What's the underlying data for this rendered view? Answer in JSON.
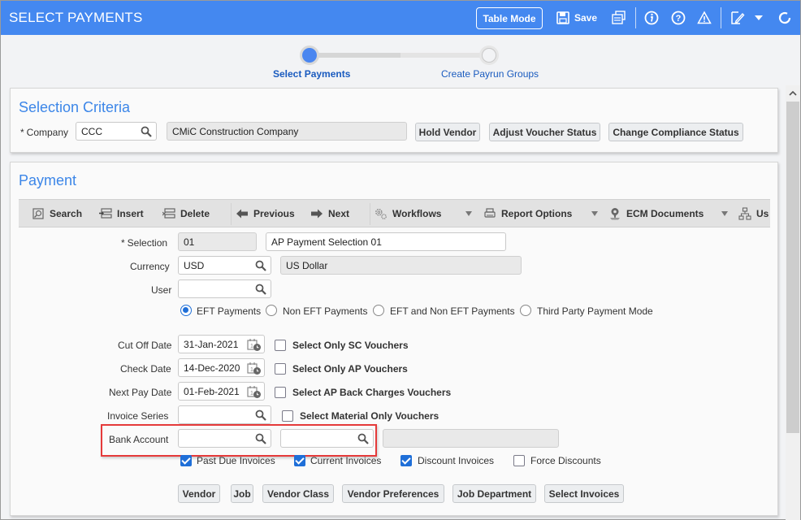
{
  "header": {
    "title": "SELECT PAYMENTS",
    "table_mode_label": "Table Mode",
    "save_label": "Save",
    "icons": [
      "save-icon",
      "report-icon",
      "info-icon",
      "help-icon",
      "warning-icon",
      "edit-icon",
      "dropdown-icon",
      "refresh-icon"
    ]
  },
  "train": {
    "steps": [
      {
        "label": "Select Payments",
        "state": "active"
      },
      {
        "label": "Create Payrun Groups",
        "state": "inactive"
      }
    ]
  },
  "selection_criteria": {
    "title": "Selection Criteria",
    "company_label": "Company",
    "company_value": "CCC",
    "company_name": "CMiC Construction Company",
    "buttons": [
      "Hold Vendor",
      "Adjust Voucher Status",
      "Change Compliance Status"
    ]
  },
  "payment": {
    "title": "Payment",
    "toolbar": {
      "search": "Search",
      "insert": "Insert",
      "delete": "Delete",
      "previous": "Previous",
      "next": "Next",
      "workflows": "Workflows",
      "report_options": "Report Options",
      "ecm_documents": "ECM Documents",
      "user": "Us"
    },
    "fields": {
      "selection_label": "Selection",
      "selection_code": "01",
      "selection_desc": "AP Payment Selection 01",
      "currency_label": "Currency",
      "currency_code": "USD",
      "currency_name": "US Dollar",
      "user_label": "User",
      "user_value": "",
      "cutoff_label": "Cut Off Date",
      "cutoff_value": "31-Jan-2021",
      "check_label": "Check Date",
      "check_value": "14-Dec-2020",
      "nextpay_label": "Next Pay Date",
      "nextpay_value": "01-Feb-2021",
      "invoice_series_label": "Invoice Series",
      "invoice_series_value": "",
      "bank_account_label": "Bank Account",
      "bank_account_value_1": "",
      "bank_account_value_2": "",
      "bank_account_name": ""
    },
    "payment_modes": [
      {
        "label": "EFT Payments",
        "selected": true
      },
      {
        "label": "Non EFT Payments",
        "selected": false
      },
      {
        "label": "EFT and Non EFT Payments",
        "selected": false
      },
      {
        "label": "Third Party Payment Mode",
        "selected": false
      }
    ],
    "voucher_filters": [
      {
        "label": "Select Only SC Vouchers",
        "checked": false
      },
      {
        "label": "Select Only AP Vouchers",
        "checked": false
      },
      {
        "label": "Select AP Back Charges Vouchers",
        "checked": false
      },
      {
        "label": "Select Material Only Vouchers",
        "checked": false
      }
    ],
    "invoice_types": [
      {
        "label": "Past Due Invoices",
        "checked": true
      },
      {
        "label": "Current Invoices",
        "checked": true
      },
      {
        "label": "Discount Invoices",
        "checked": true
      },
      {
        "label": "Force Discounts",
        "checked": false
      }
    ],
    "buttons": [
      "Vendor",
      "Job",
      "Vendor Class",
      "Vendor Preferences",
      "Job Department",
      "Select Invoices"
    ]
  },
  "colors": {
    "header_bg": "#4488f0",
    "accent": "#3c86e8",
    "highlight_border": "#e53a3a",
    "checkbox_on": "#1f6fd8"
  }
}
